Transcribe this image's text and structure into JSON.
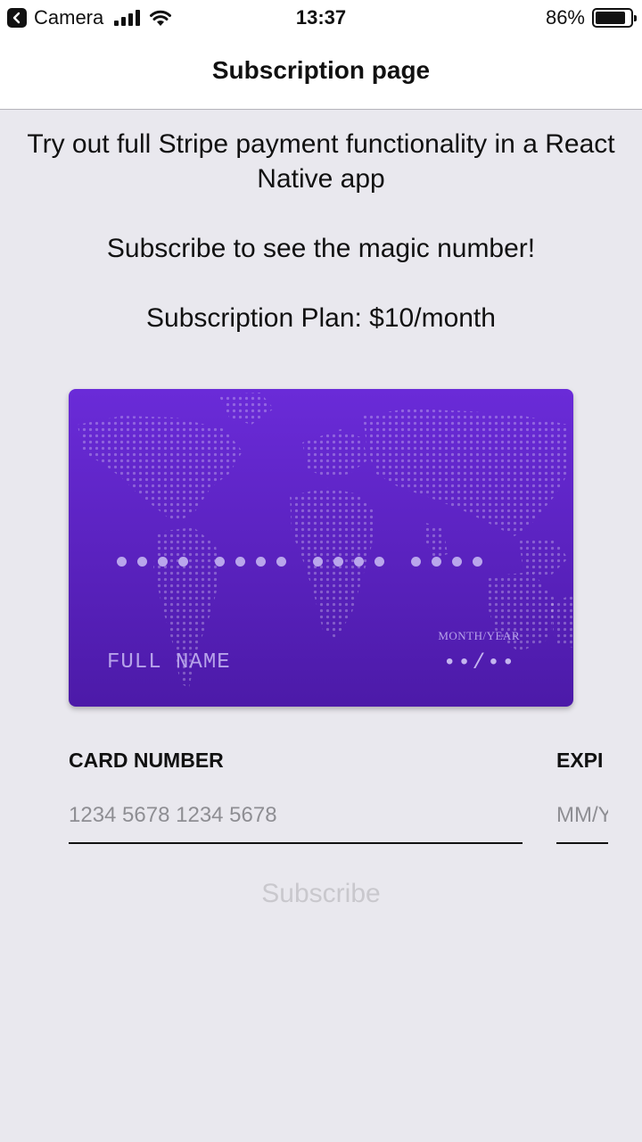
{
  "status_bar": {
    "back_app": "Camera",
    "time": "13:37",
    "battery_percent": "86%",
    "battery_level": 0.86,
    "icons": [
      "back-icon",
      "signal-icon",
      "wifi-icon",
      "battery-icon"
    ]
  },
  "nav": {
    "title": "Subscription page"
  },
  "content": {
    "intro": "Try out full Stripe payment functionality in a React Native app",
    "prompt": "Subscribe to see the magic number!",
    "plan": "Subscription Plan: $10/month"
  },
  "card_preview": {
    "number_mask": [
      "••••",
      "••••",
      "••••",
      "••••"
    ],
    "name_placeholder": "FULL NAME",
    "expiry_label": "MONTH/YEAR",
    "expiry_placeholder": "••/••",
    "colors": {
      "top": "#6a2bd8",
      "bottom": "#4c1aa8",
      "dots": "#b9a6ec"
    }
  },
  "form": {
    "card_number": {
      "label": "CARD NUMBER",
      "placeholder": "1234 5678 1234 5678",
      "value": ""
    },
    "expiry": {
      "label": "EXPI",
      "placeholder": "MM/Y",
      "value": ""
    }
  },
  "actions": {
    "subscribe_label": "Subscribe",
    "subscribe_enabled": false
  }
}
